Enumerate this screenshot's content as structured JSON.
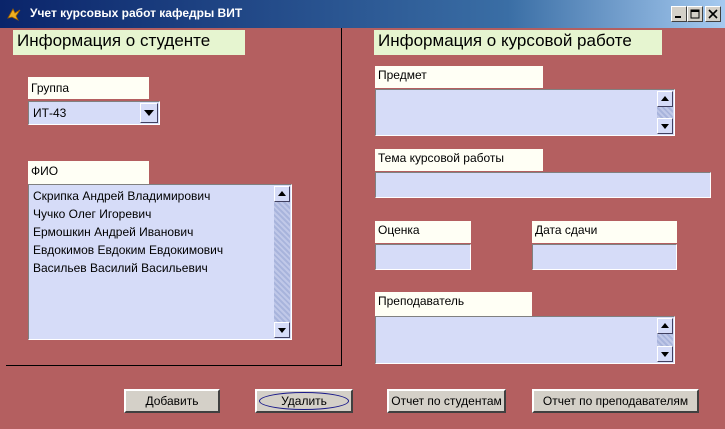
{
  "window": {
    "title": "Учет курсовых работ кафедры ВИТ",
    "icon": "app-icon"
  },
  "student": {
    "heading": "Информация о студенте",
    "group_label": "Группа",
    "group_value": "ИТ-43",
    "fio_label": "ФИО",
    "students": [
      "Скрипка Андрей Владимирович",
      "Чучко Олег Игоревич",
      "Ермошкин Андрей Иванович",
      "Евдокимов Евдоким Евдокимович",
      "Васильев Василий Васильевич"
    ]
  },
  "coursework": {
    "heading": "Информация о курсовой работе",
    "subject_label": "Предмет",
    "subject_value": "",
    "topic_label": "Тема курсовой работы",
    "topic_value": "",
    "grade_label": "Оценка",
    "grade_value": "",
    "date_label": "Дата сдачи",
    "date_value": "",
    "teacher_label": "Преподаватель",
    "teacher_value": ""
  },
  "buttons": {
    "add": "Добавить",
    "delete": "Удалить",
    "report_students": "Отчет по студентам",
    "report_teachers": "Отчет по преподавателям"
  },
  "colors": {
    "background": "#b45f60",
    "field": "#d6dcf8",
    "heading_bg": "#e6f5d0",
    "titlebar": "#0a246a"
  }
}
